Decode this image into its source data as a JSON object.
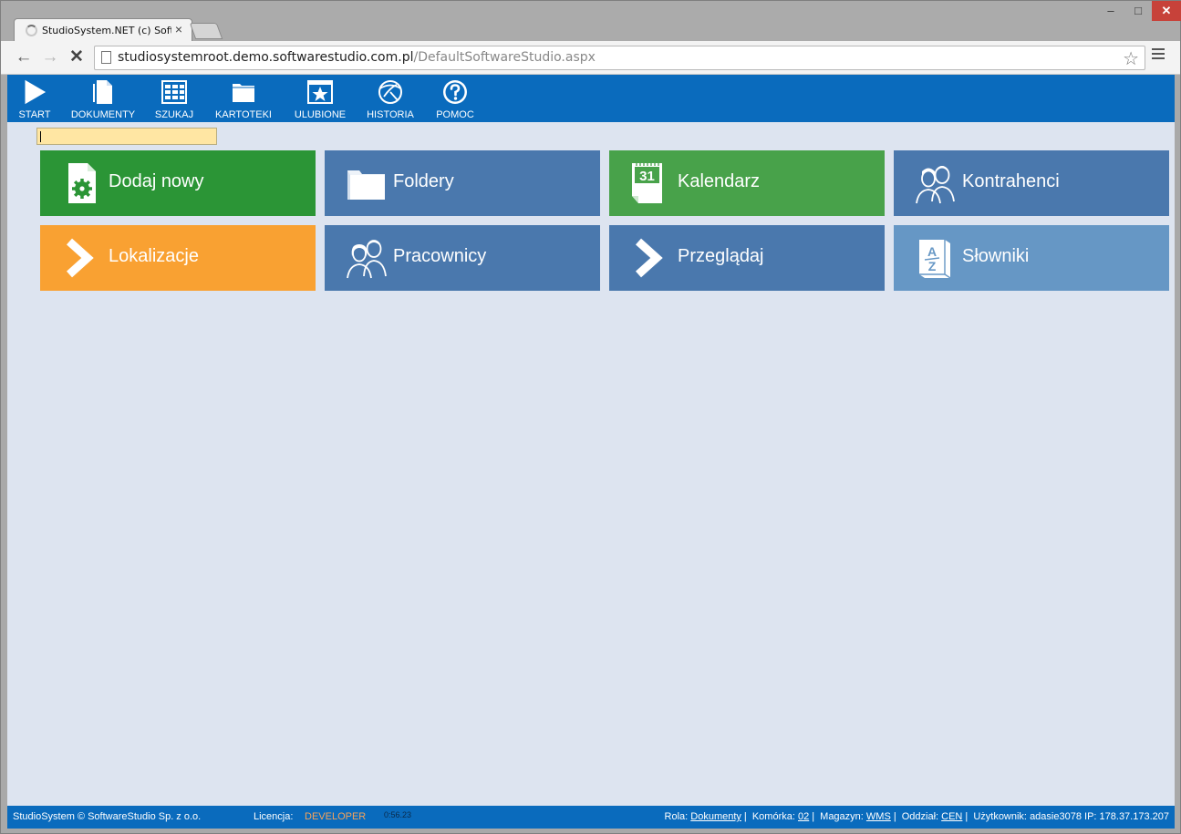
{
  "browser": {
    "tab_title": "StudioSystem.NET (c) Soft",
    "tab_close": "×",
    "url_host": "studiosystemroot.demo.softwarestudio.com.pl",
    "url_path": "/DefaultSoftwareStudio.aspx",
    "win_min": "–",
    "win_max": "□",
    "win_close": "✕",
    "back": "←",
    "forward": "→",
    "stop": "✕",
    "star": "☆"
  },
  "nav": {
    "items": [
      {
        "label": "START",
        "icon": "play-icon"
      },
      {
        "label": "DOKUMENTY",
        "icon": "documents-icon"
      },
      {
        "label": "SZUKAJ",
        "icon": "search-grid-icon"
      },
      {
        "label": "KARTOTEKI",
        "icon": "folder-icon"
      },
      {
        "label": "ULUBIONE",
        "icon": "star-icon"
      },
      {
        "label": "HISTORIA",
        "icon": "history-icon"
      },
      {
        "label": "POMOC",
        "icon": "help-icon"
      }
    ]
  },
  "search": {
    "value": ""
  },
  "tiles": [
    {
      "label": "Dodaj nowy",
      "icon": "document-gear-icon",
      "color": "#2b9536"
    },
    {
      "label": "Foldery",
      "icon": "folder-icon",
      "color": "#4a78ad"
    },
    {
      "label": "Kalendarz",
      "icon": "calendar-icon",
      "color": "#48a24a",
      "day": "31"
    },
    {
      "label": "Kontrahenci",
      "icon": "people-icon",
      "color": "#4a78ad"
    },
    {
      "label": "Lokalizacje",
      "icon": "chevron-right-icon",
      "color": "#f9a132"
    },
    {
      "label": "Pracownicy",
      "icon": "people-icon",
      "color": "#4a78ad"
    },
    {
      "label": "Przeglądaj",
      "icon": "chevron-right-icon",
      "color": "#4a78ad"
    },
    {
      "label": "Słowniki",
      "icon": "dictionary-icon",
      "color": "#6697c5"
    }
  ],
  "status": {
    "app": "StudioSystem © SoftwareStudio Sp. z o.o.",
    "license_label": "Licencja:",
    "license_value": "DEVELOPER",
    "timer": "0:56.23",
    "role_label": "Rola:",
    "role_value": "Dokumenty",
    "cell_label": "Komórka:",
    "cell_value": "02",
    "warehouse_label": "Magazyn:",
    "warehouse_value": "WMS",
    "branch_label": "Oddział:",
    "branch_value": "CEN",
    "user_label": "Użytkownik:",
    "user_value": "adasie3078",
    "ip_label": "IP:",
    "ip_value": "178.37.173.207"
  }
}
